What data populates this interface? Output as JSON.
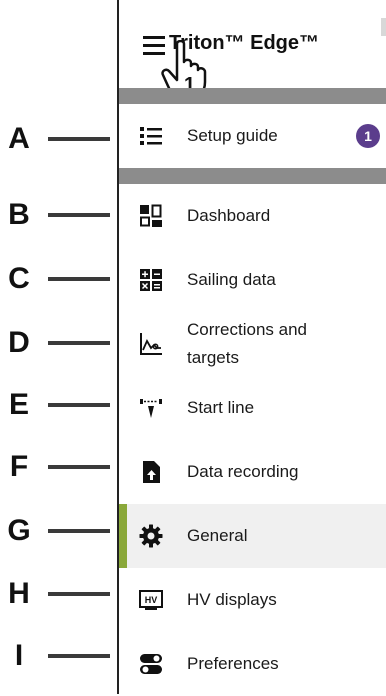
{
  "app": {
    "title": "Triton™ Edge™",
    "step_number": "1"
  },
  "callouts": [
    "A",
    "B",
    "C",
    "D",
    "E",
    "F",
    "G",
    "H",
    "I"
  ],
  "menu": {
    "setup": {
      "label": "Setup guide",
      "badge": "1"
    },
    "items": [
      {
        "label": "Dashboard",
        "icon": "dashboard-icon"
      },
      {
        "label": "Sailing data",
        "icon": "sailing-data-icon"
      },
      {
        "label": "Corrections and targets",
        "icon": "corrections-chart-icon"
      },
      {
        "label": "Start line",
        "icon": "start-line-icon"
      },
      {
        "label": "Data recording",
        "icon": "data-recording-icon"
      },
      {
        "label": "General",
        "icon": "gear-icon",
        "active": true
      },
      {
        "label": "HV displays",
        "icon": "hv-display-icon"
      },
      {
        "label": "Preferences",
        "icon": "toggles-icon"
      }
    ]
  },
  "colors": {
    "active_bar": "#8aa83a",
    "badge": "#5b3d8c",
    "separator": "#8c8c8c"
  }
}
